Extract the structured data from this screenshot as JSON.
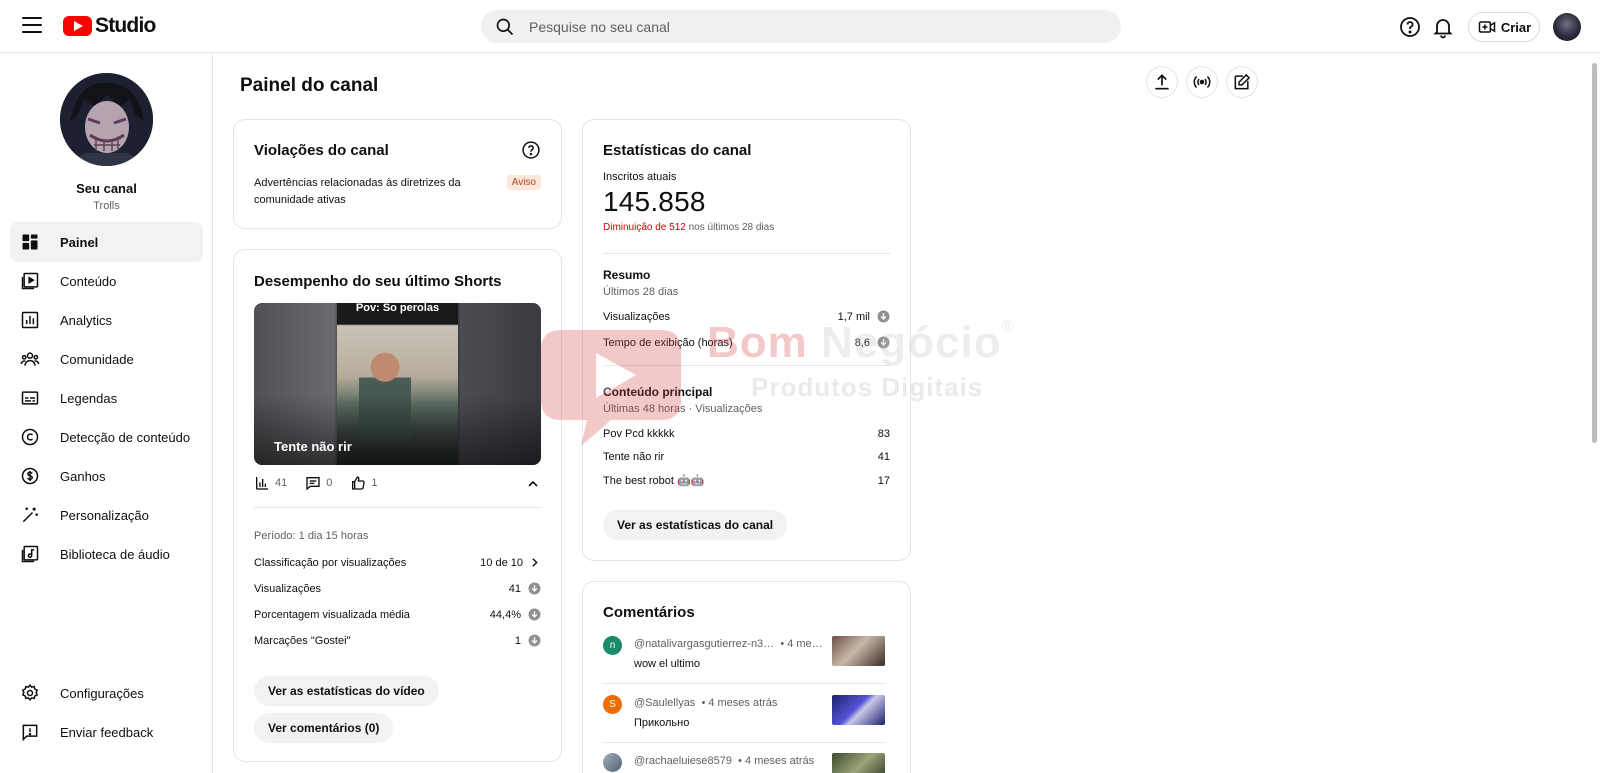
{
  "app": {
    "logo_text": "Studio"
  },
  "search": {
    "placeholder": "Pesquise no seu canal"
  },
  "header": {
    "create_label": "Criar"
  },
  "channel": {
    "name": "Seu canal",
    "handle": "Trolls"
  },
  "sidebar": {
    "items": [
      {
        "label": "Painel",
        "icon": "dashboard-icon",
        "active": true
      },
      {
        "label": "Conteúdo",
        "icon": "content-icon"
      },
      {
        "label": "Analytics",
        "icon": "analytics-icon"
      },
      {
        "label": "Comunidade",
        "icon": "community-icon"
      },
      {
        "label": "Legendas",
        "icon": "subtitles-icon"
      },
      {
        "label": "Detecção de conteúdo",
        "icon": "copyright-icon"
      },
      {
        "label": "Ganhos",
        "icon": "dollar-icon"
      },
      {
        "label": "Personalização",
        "icon": "magic-wand-icon"
      },
      {
        "label": "Biblioteca de áudio",
        "icon": "audio-library-icon"
      }
    ],
    "bottom": [
      {
        "label": "Configurações",
        "icon": "gear-icon"
      },
      {
        "label": "Enviar feedback",
        "icon": "feedback-icon"
      }
    ]
  },
  "page": {
    "title": "Painel do canal"
  },
  "violations": {
    "title": "Violações do canal",
    "text": "Advertências relacionadas às diretrizes da comunidade ativas",
    "badge": "Aviso"
  },
  "shorts": {
    "title": "Desempenho do seu último Shorts",
    "thumb_top_text": "Pov: So perolas",
    "thumb_caption": "Tente não rir",
    "views_count": "41",
    "comments_count": "0",
    "likes_count": "1",
    "period": "Período: 1 dia 15 horas",
    "rows": [
      {
        "label": "Classificação por visualizações",
        "value": "10 de 10"
      },
      {
        "label": "Visualizações",
        "value": "41"
      },
      {
        "label": "Porcentagem visualizada média",
        "value": "44,4%"
      },
      {
        "label": "Marcações \"Gostei\"",
        "value": "1"
      }
    ],
    "btn_stats": "Ver as estatísticas do vídeo",
    "btn_comments": "Ver comentários (0)"
  },
  "stats": {
    "title": "Estatísticas do canal",
    "subs_label": "Inscritos atuais",
    "subs_value": "145.858",
    "decline_red": "Diminuição de 512",
    "decline_rest": " nos últimos 28 dias",
    "summary_title": "Resumo",
    "summary_sub": "Últimos 28 dias",
    "summary_rows": [
      {
        "label": "Visualizações",
        "value": "1,7 mil"
      },
      {
        "label": "Tempo de exibição (horas)",
        "value": "8,6"
      }
    ],
    "top_title": "Conteúdo principal",
    "top_sub": "Últimas 48 horas · Visualizações",
    "top_rows": [
      {
        "label": "Pov Pcd kkkkk",
        "value": "83"
      },
      {
        "label": "Tente não rir",
        "value": "41"
      },
      {
        "label": "The best robot 🤖🤖",
        "value": "17"
      }
    ],
    "button": "Ver as estatísticas do canal"
  },
  "comments": {
    "title": "Comentários",
    "items": [
      {
        "initial": "n",
        "author": "@natalivargasgutierrez-n3…",
        "time": "• 4 me…",
        "text": "wow el ultimo",
        "color": "#1a8a6b"
      },
      {
        "initial": "S",
        "author": "@Saulellyas",
        "time": "• 4 meses atrás",
        "text": "Прикольно",
        "color": "#ef6c00"
      },
      {
        "initial": "",
        "author": "@rachaeluiese8579",
        "time": "• 4 meses atrás",
        "text": "",
        "color": "#7a8a9a"
      }
    ]
  },
  "watermark": {
    "line1_a": "Bom ",
    "line1_b": "Negócio",
    "mark": "®",
    "line2": "Produtos Digitais"
  }
}
